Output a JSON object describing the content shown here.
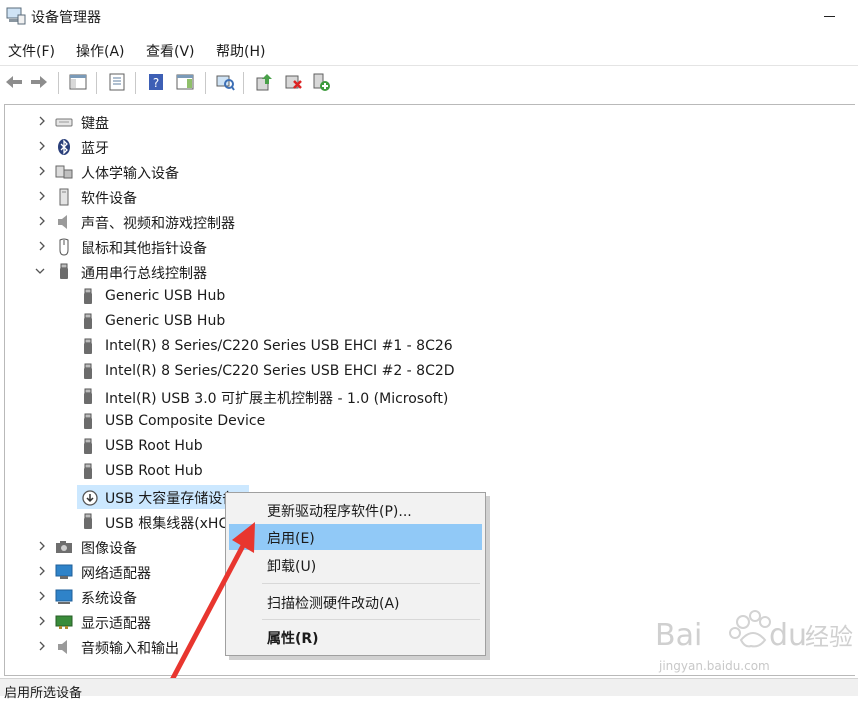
{
  "window": {
    "title": "设备管理器"
  },
  "menu": [
    "文件(F)",
    "操作(A)",
    "查看(V)",
    "帮助(H)"
  ],
  "toolbar": {
    "buttons": [
      "back-icon",
      "forward-icon",
      "show-hide-console-tree-icon",
      "properties-icon",
      "help-icon",
      "action-pane-icon",
      "scan-hardware-icon",
      "update-driver-icon",
      "uninstall-device-icon",
      "enable-device-icon"
    ]
  },
  "tree": {
    "categories_top": [
      {
        "label": "键盘",
        "icon": "keyboard-icon"
      },
      {
        "label": "蓝牙",
        "icon": "bluetooth-icon"
      },
      {
        "label": "人体学输入设备",
        "icon": "hid-icon"
      },
      {
        "label": "软件设备",
        "icon": "software-device-icon"
      },
      {
        "label": "声音、视频和游戏控制器",
        "icon": "speaker-icon"
      },
      {
        "label": "鼠标和其他指针设备",
        "icon": "mouse-icon"
      }
    ],
    "usb_category": {
      "label": "通用串行总线控制器",
      "icon": "usb-icon"
    },
    "usb_children": [
      "Generic USB Hub",
      "Generic USB Hub",
      "Intel(R) 8 Series/C220 Series USB EHCI #1 - 8C26",
      "Intel(R) 8 Series/C220 Series USB EHCI #2 - 8C2D",
      "Intel(R) USB 3.0 可扩展主机控制器 - 1.0 (Microsoft)",
      "USB Composite Device",
      "USB Root Hub",
      "USB Root Hub",
      "USB 大容量存储设备",
      "USB 根集线器(xHCI)"
    ],
    "categories_bottom": [
      {
        "label": "图像设备",
        "icon": "camera-icon"
      },
      {
        "label": "网络适配器",
        "icon": "network-adapter-icon"
      },
      {
        "label": "系统设备",
        "icon": "system-device-icon"
      },
      {
        "label": "显示适配器",
        "icon": "display-adapter-icon"
      },
      {
        "label": "音频输入和输出",
        "icon": "audio-io-icon"
      }
    ]
  },
  "context_menu": {
    "items": [
      "更新驱动程序软件(P)...",
      "启用(E)",
      "卸载(U)",
      "扫描检测硬件改动(A)",
      "属性(R)"
    ],
    "highlighted": "启用(E)"
  },
  "status": {
    "text": "启用所选设备"
  },
  "watermark": {
    "brand": "Bai du 经验",
    "url": "jingyan.baidu.com"
  },
  "colors": {
    "selection": "#cce8ff",
    "menu_highlight": "#91c9f7",
    "annotation_arrow": "#e8362f"
  }
}
